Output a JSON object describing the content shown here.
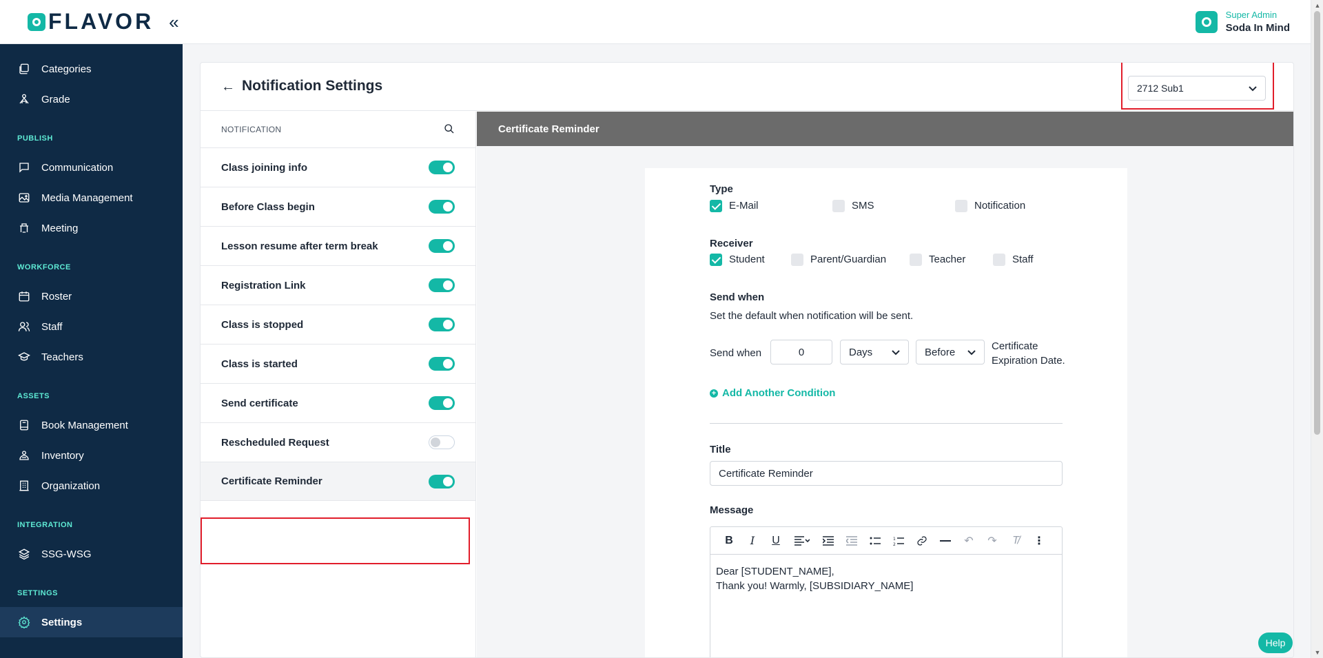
{
  "brand": {
    "logo_text": "FLAVOR",
    "collapse_glyph": "«"
  },
  "user": {
    "role": "Super Admin",
    "name": "Soda In Mind"
  },
  "sidebar": {
    "items": [
      {
        "label": "Categories",
        "icon": "categories-icon"
      },
      {
        "label": "Grade",
        "icon": "grade-icon"
      },
      {
        "label": "Communication",
        "icon": "chat-icon"
      },
      {
        "label": "Media Management",
        "icon": "media-icon"
      },
      {
        "label": "Meeting",
        "icon": "meeting-icon"
      },
      {
        "label": "Roster",
        "icon": "calendar-icon"
      },
      {
        "label": "Staff",
        "icon": "staff-icon"
      },
      {
        "label": "Teachers",
        "icon": "graduation-cap-icon"
      },
      {
        "label": "Book Management",
        "icon": "book-icon"
      },
      {
        "label": "Inventory",
        "icon": "inventory-icon"
      },
      {
        "label": "Organization",
        "icon": "building-icon"
      },
      {
        "label": "SSG-WSG",
        "icon": "layers-icon"
      },
      {
        "label": "Settings",
        "icon": "gear-icon"
      }
    ],
    "sections": [
      "PUBLISH",
      "WORKFORCE",
      "ASSETS",
      "INTEGRATION",
      "SETTINGS"
    ],
    "active": "Settings"
  },
  "page": {
    "title": "Notification Settings",
    "subsidiary_select": {
      "value": "2712 Sub1"
    }
  },
  "notification_list": {
    "header": "NOTIFICATION",
    "items": [
      {
        "label": "Class joining info",
        "enabled": true
      },
      {
        "label": "Before Class begin",
        "enabled": true
      },
      {
        "label": "Lesson resume after term break",
        "enabled": true
      },
      {
        "label": "Registration Link",
        "enabled": true
      },
      {
        "label": "Class is stopped",
        "enabled": true
      },
      {
        "label": "Class is started",
        "enabled": true
      },
      {
        "label": "Send certificate",
        "enabled": true
      },
      {
        "label": "Rescheduled Request",
        "enabled": false
      },
      {
        "label": "Certificate Reminder",
        "enabled": true
      }
    ],
    "selected": "Certificate Reminder"
  },
  "detail": {
    "header": "Certificate Reminder",
    "type": {
      "label": "Type",
      "options": [
        {
          "label": "E-Mail",
          "checked": true
        },
        {
          "label": "SMS",
          "checked": false
        },
        {
          "label": "Notification",
          "checked": false
        }
      ]
    },
    "receiver": {
      "label": "Receiver",
      "options": [
        {
          "label": "Student",
          "checked": true
        },
        {
          "label": "Parent/Guardian",
          "checked": false
        },
        {
          "label": "Teacher",
          "checked": false
        },
        {
          "label": "Staff",
          "checked": false
        }
      ]
    },
    "send_when": {
      "label": "Send when",
      "description": "Set the default when notification will be sent.",
      "row_label": "Send when",
      "amount": "0",
      "unit": "Days",
      "relation": "Before",
      "suffix_line1": "Certificate",
      "suffix_line2": "Expiration Date.",
      "add_condition": "Add Another Condition"
    },
    "title": {
      "label": "Title",
      "value": "Certificate Reminder"
    },
    "message": {
      "label": "Message",
      "line1": "Dear [STUDENT_NAME],",
      "line2": "Thank you! Warmly, [SUBSIDIARY_NAME]"
    }
  },
  "help": {
    "label": "Help"
  }
}
